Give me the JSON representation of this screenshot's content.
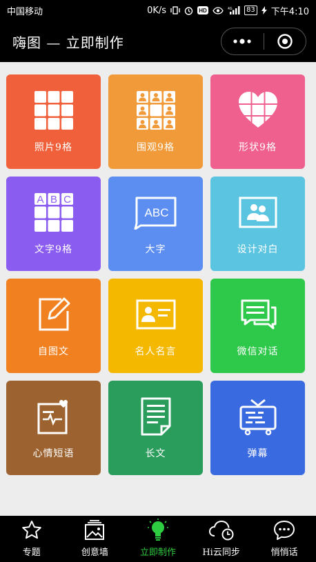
{
  "status_bar": {
    "carrier": "中国移动",
    "speed": "0K/s",
    "battery": "83",
    "time": "下午4:10"
  },
  "header": {
    "title": "嗨图 — 立即制作"
  },
  "tiles": [
    {
      "label": "照片9格",
      "color": "#f0603a",
      "icon": "grid-icon"
    },
    {
      "label": "围观9格",
      "color": "#f09a3a",
      "icon": "people-grid-icon"
    },
    {
      "label": "形状9格",
      "color": "#f0608e",
      "icon": "heart-grid-icon"
    },
    {
      "label": "文字9格",
      "color": "#8b5cf0",
      "icon": "abc-grid-icon"
    },
    {
      "label": "大字",
      "color": "#5b8ef0",
      "icon": "abc-bubble-icon"
    },
    {
      "label": "设计对白",
      "color": "#5bc4e0",
      "icon": "people-card-icon"
    },
    {
      "label": "自图文",
      "color": "#f08020",
      "icon": "edit-icon"
    },
    {
      "label": "名人名言",
      "color": "#f5b800",
      "icon": "id-card-icon"
    },
    {
      "label": "微信对话",
      "color": "#2ec84a",
      "icon": "chat-icon"
    },
    {
      "label": "心情短语",
      "color": "#9c6330",
      "icon": "mood-note-icon"
    },
    {
      "label": "长文",
      "color": "#2a9c5c",
      "icon": "document-icon"
    },
    {
      "label": "弹幕",
      "color": "#3a6ae0",
      "icon": "tv-icon"
    }
  ],
  "tabs": [
    {
      "label": "专题",
      "icon": "star-icon",
      "active": false
    },
    {
      "label": "创意墙",
      "icon": "image-stack-icon",
      "active": false
    },
    {
      "label": "立即制作",
      "icon": "lightbulb-icon",
      "active": true
    },
    {
      "label": "Hi云同步",
      "icon": "cloud-clock-icon",
      "active": false
    },
    {
      "label": "悄悄话",
      "icon": "chat-bubble-icon",
      "active": false
    }
  ],
  "colors": {
    "active_tab": "#2ecc40",
    "background": "#ededed"
  }
}
